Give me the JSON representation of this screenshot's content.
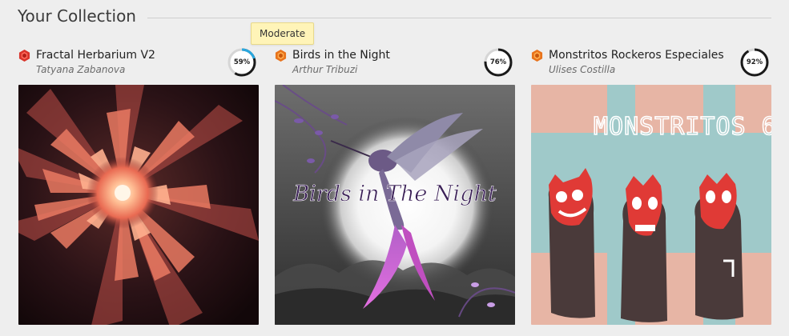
{
  "section": {
    "title": "Your Collection"
  },
  "tooltip": {
    "text": "Moderate"
  },
  "colors": {
    "progress_track": "#d6d6d6",
    "progress_ring": "#1a1a1a",
    "progress_accent": "#29a8e0",
    "rarity_red": "#d9342b",
    "rarity_orange": "#e8731c"
  },
  "cards": [
    {
      "title": "Fractal Herbarium V2",
      "artist": "Tatyana Zabanova",
      "progress_label": "59%",
      "progress": 0.59,
      "rarity_icon": "red-gem-icon",
      "artwork_icon": "fractal-flower-artwork"
    },
    {
      "title": "Birds in the Night",
      "artist": "Arthur Tribuzi",
      "progress_label": "76%",
      "progress": 0.76,
      "rarity_icon": "orange-gem-icon",
      "artwork_icon": "hummingbird-artwork",
      "artwork_text": "Birds in The Night"
    },
    {
      "title": "Monstritos Rockeros Especiales",
      "artist": "Ulises Costilla",
      "progress_label": "92%",
      "progress": 0.92,
      "rarity_icon": "orange-gem-icon",
      "artwork_icon": "monsters-artwork",
      "artwork_text": "MONSTRITOS 6"
    }
  ]
}
